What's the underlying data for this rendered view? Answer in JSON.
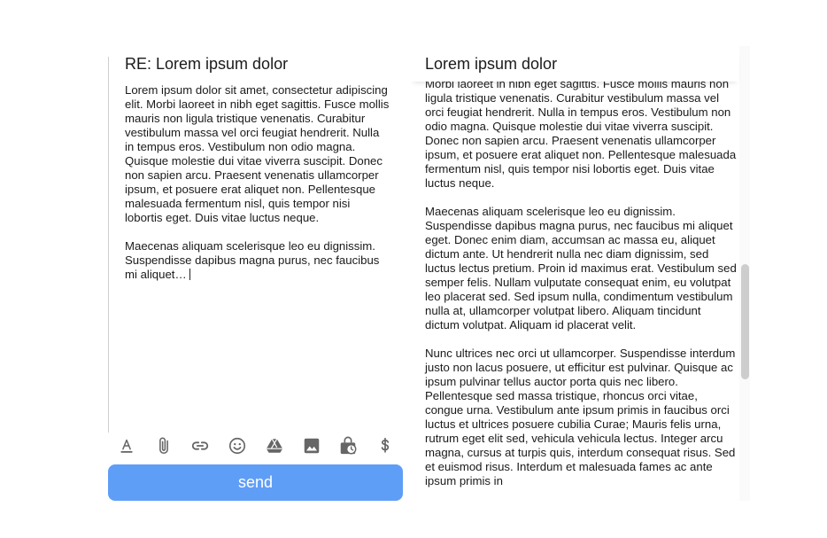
{
  "compose": {
    "title": "RE: Lorem ipsum dolor",
    "paragraph_1": "Lorem ipsum dolor sit amet, consectetur adipiscing elit. Morbi laoreet in nibh eget sagittis. Fusce mollis mauris non ligula tristique venenatis. Curabitur vestibulum massa vel orci feugiat hendrerit. Nulla in tempus eros. Vestibulum non odio magna. Quisque molestie dui vitae viverra suscipit. Donec non sapien arcu. Praesent venenatis ullamcorper ipsum, et posuere erat aliquet non. Pellentesque malesuada fermentum nisl, quis tempor nisi lobortis eget. Duis vitae luctus neque.",
    "paragraph_2": "Maecenas aliquam scelerisque leo eu dignissim. Suspendisse dapibus magna purus, nec faucibus mi aliquet…",
    "send_label": "send"
  },
  "toolbar": {
    "icons": [
      "text-format-icon",
      "attachment-icon",
      "link-icon",
      "emoji-icon",
      "drive-icon",
      "image-icon",
      "schedule-icon",
      "dollar-icon"
    ]
  },
  "original": {
    "title": "Lorem ipsum dolor",
    "paragraphs": [
      "Morbi laoreet in nibh eget sagittis. Fusce mollis mauris non ligula tristique venenatis. Curabitur vestibulum massa vel orci feugiat hendrerit. Nulla in tempus eros. Vestibulum non odio magna. Quisque molestie dui vitae viverra suscipit. Donec non sapien arcu. Praesent venenatis ullamcorper ipsum, et posuere erat aliquet non. Pellentesque malesuada fermentum nisl, quis tempor nisi lobortis eget. Duis vitae luctus neque.",
      "Maecenas aliquam scelerisque leo eu dignissim. Suspendisse dapibus magna purus, nec faucibus mi aliquet eget. Donec enim diam, accumsan ac massa eu, aliquet dictum ante. Ut hendrerit nulla nec diam dignissim, sed luctus lectus pretium. Proin id maximus erat. Vestibulum sed semper felis. Nullam vulputate consequat enim, eu volutpat leo placerat sed. Sed ipsum nulla, condimentum vestibulum nulla at, ullamcorper volutpat libero. Aliquam tincidunt dictum volutpat. Aliquam id placerat velit.",
      "Nunc ultrices nec orci ut ullamcorper. Suspendisse interdum justo non lacus posuere, ut efficitur est pulvinar. Quisque ac ipsum pulvinar tellus auctor porta quis nec libero. Pellentesque sed massa tristique, rhoncus orci vitae, congue urna. Vestibulum ante ipsum primis in faucibus orci luctus et ultrices posuere cubilia Curae; Mauris felis urna, rutrum eget elit sed, vehicula vehicula lectus. Integer arcu magna, cursus at turpis quis, interdum consequat risus. Sed et euismod risus. Interdum et malesuada fames ac ante ipsum primis in"
    ]
  },
  "colors": {
    "send_button": "#5f9ef7",
    "icon": "#666666",
    "text": "#1a1a1a"
  }
}
